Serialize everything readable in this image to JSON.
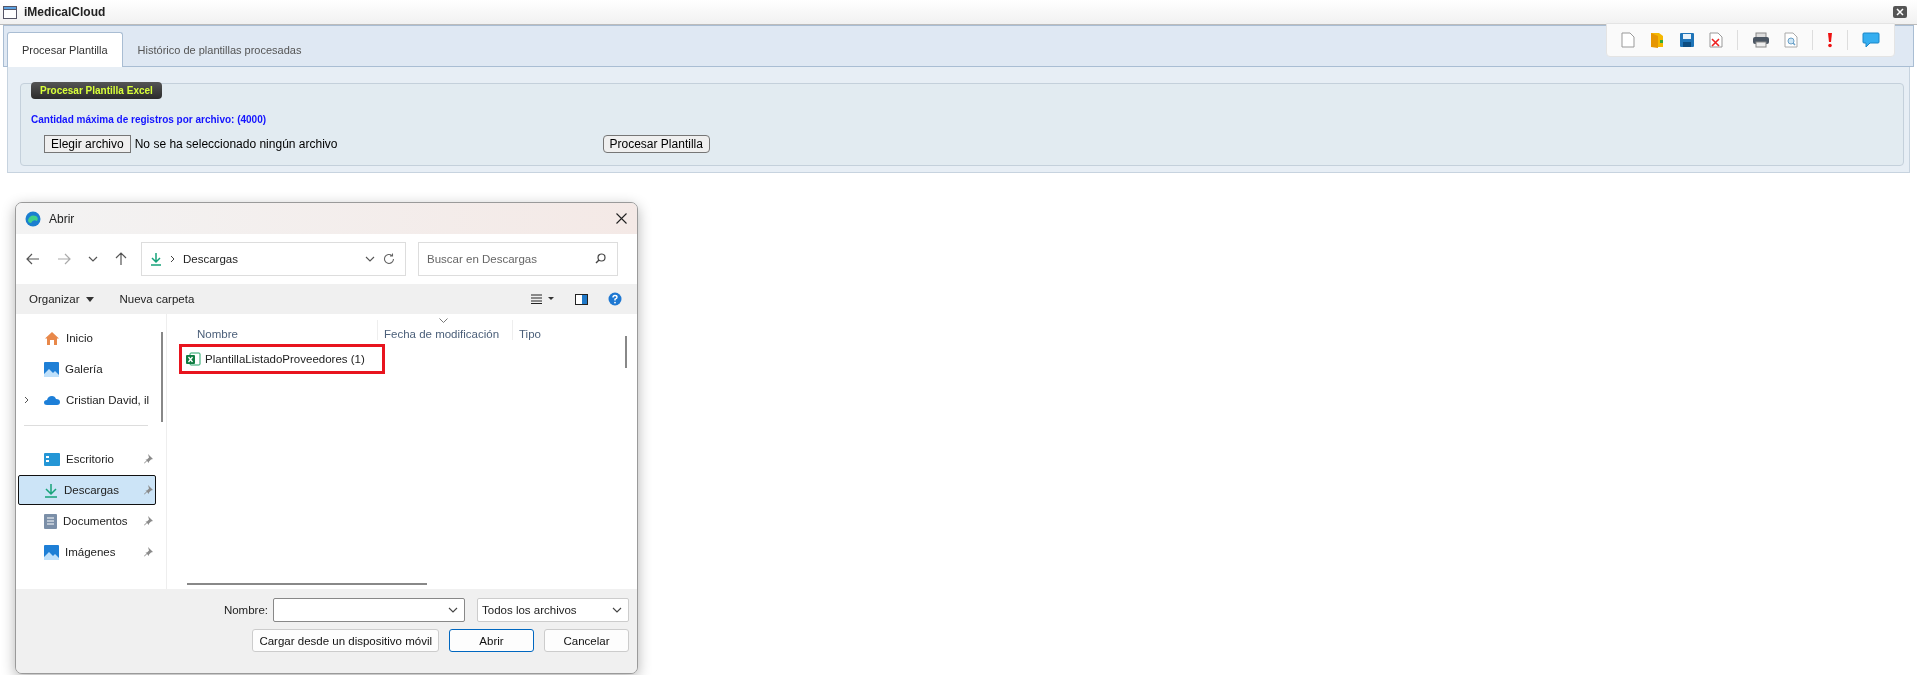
{
  "window": {
    "title": "iMedicalCloud"
  },
  "tabs": [
    {
      "label": "Procesar Plantilla",
      "selected": true
    },
    {
      "label": "Histórico de plantillas procesadas",
      "selected": false
    }
  ],
  "panel": {
    "legend": "Procesar Plantilla Excel",
    "limit_note": "Cantidad máxima de registros por archivo: (4000)",
    "choose_button": "Elegir archivo",
    "file_status": "No se ha seleccionado ningún archivo",
    "process_button": "Procesar Plantilla"
  },
  "dialog": {
    "title": "Abrir",
    "path": "Descargas",
    "search": {
      "placeholder": "Buscar en Descargas"
    },
    "commands": [
      "Organizar",
      "Nueva carpeta"
    ],
    "sidebar": {
      "groups": [
        {
          "items": [
            {
              "label": "Inicio",
              "kind": "home",
              "selected": false,
              "pinned": false
            },
            {
              "label": "Galería",
              "kind": "gallery",
              "selected": false,
              "pinned": false
            },
            {
              "label": "Cristian David, il",
              "kind": "cloud",
              "selected": false,
              "pinned": false
            }
          ]
        },
        {
          "items": [
            {
              "label": "Escritorio",
              "kind": "desktop",
              "selected": false,
              "pinned": true
            },
            {
              "label": "Descargas",
              "kind": "download",
              "selected": true,
              "pinned": true
            },
            {
              "label": "Documentos",
              "kind": "documents",
              "selected": false,
              "pinned": true
            },
            {
              "label": "Imágenes",
              "kind": "pictures",
              "selected": false,
              "pinned": true
            }
          ]
        }
      ]
    },
    "columns": [
      "Nombre",
      "Fecha de modificación",
      "Tipo"
    ],
    "files": [
      {
        "name": "PlantillaListadoProveedores (1)",
        "highlighted": true
      }
    ],
    "filename_label": "Nombre:",
    "filter": "Todos los archivos",
    "buttons": [
      {
        "label": "Cargar desde un dispositivo móvil",
        "default": false
      },
      {
        "label": "Abrir",
        "default": true
      },
      {
        "label": "Cancelar",
        "default": false
      }
    ]
  }
}
